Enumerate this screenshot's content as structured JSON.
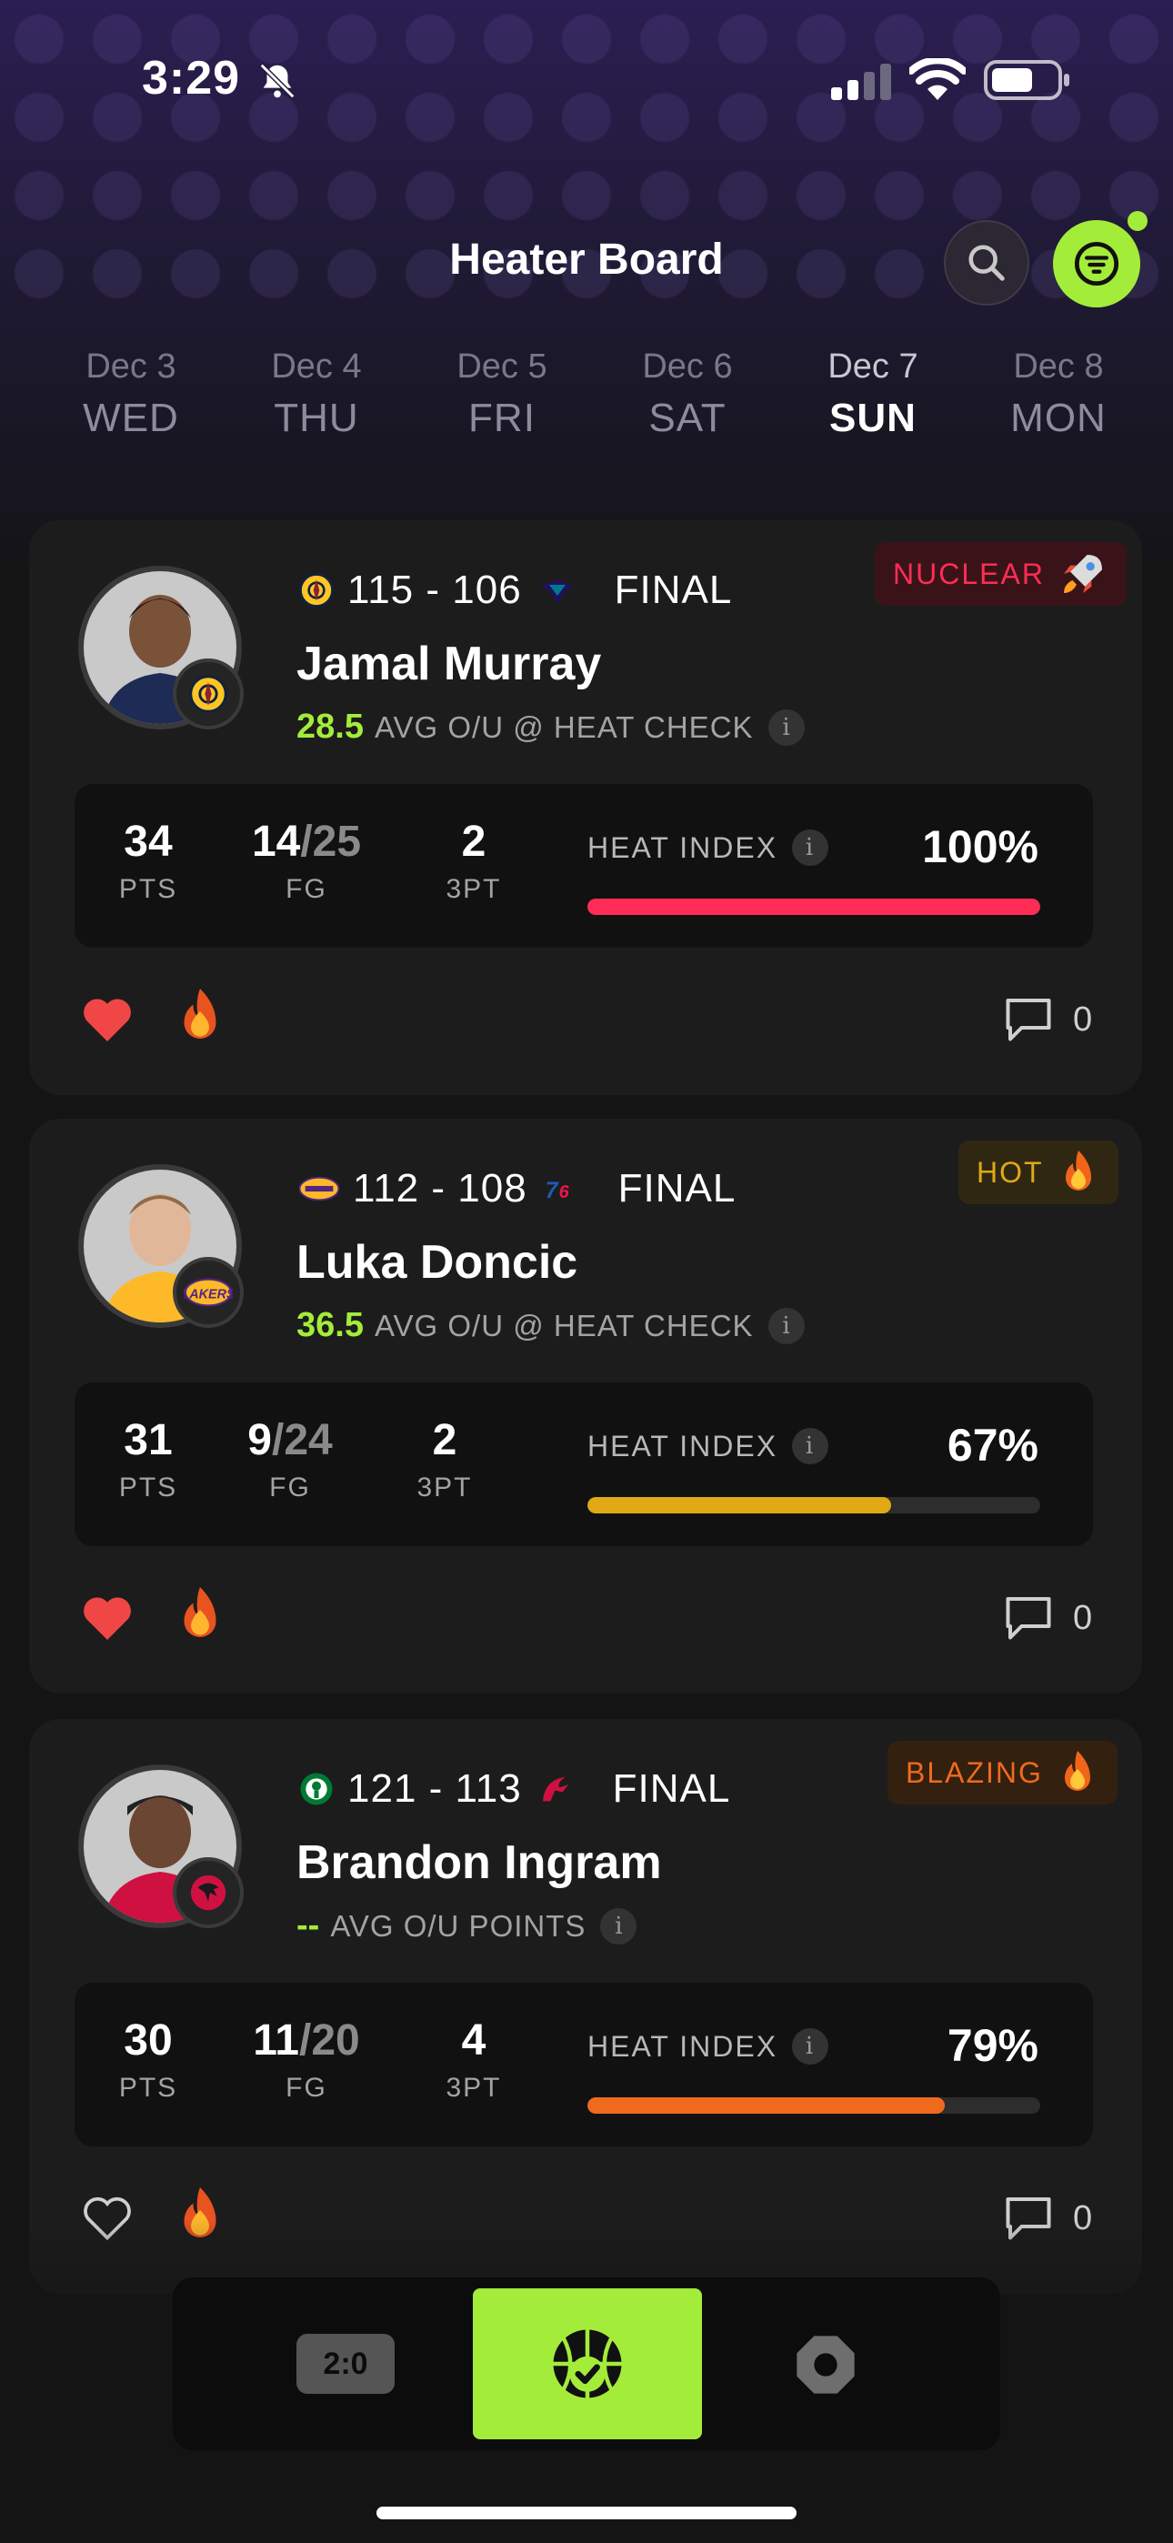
{
  "status_bar": {
    "time": "3:29"
  },
  "header": {
    "title": "Heater Board"
  },
  "dates": [
    {
      "date": "Dec 3",
      "weekday": "WED"
    },
    {
      "date": "Dec 4",
      "weekday": "THU"
    },
    {
      "date": "Dec 5",
      "weekday": "FRI"
    },
    {
      "date": "Dec 6",
      "weekday": "SAT"
    },
    {
      "date": "Dec 7",
      "weekday": "SUN",
      "active": true
    },
    {
      "date": "Dec 8",
      "weekday": "MON"
    }
  ],
  "cards": [
    {
      "score": "115 - 106",
      "status": "FINAL",
      "home_team_icon": "nuggets-logo-icon",
      "away_team_icon": "hornets-logo-icon",
      "player_name": "Jamal Murray",
      "ou_value": "28.5",
      "ou_label": "AVG O/U @ HEAT CHECK",
      "tier": "NUCLEAR",
      "tier_icon": "rocket-icon",
      "tier_color": "#ff2d55",
      "pts": "34",
      "pts_label": "PTS",
      "fg_made": "14",
      "fg_sep": "/",
      "fg_att": "25",
      "fg_label": "FG",
      "threes": "2",
      "threes_label": "3PT",
      "heat_label": "HEAT INDEX",
      "heat_pct": "100%",
      "heat_value": 1.0,
      "heat_color": "#ff2d55",
      "liked": true,
      "comments": "0"
    },
    {
      "score": "112 - 108",
      "status": "FINAL",
      "home_team_icon": "lakers-logo-icon",
      "away_team_icon": "76ers-logo-icon",
      "player_name": "Luka Doncic",
      "ou_value": "36.5",
      "ou_label": "AVG O/U @ HEAT CHECK",
      "tier": "HOT",
      "tier_icon": "fire-icon",
      "tier_color": "#e0a915",
      "pts": "31",
      "pts_label": "PTS",
      "fg_made": "9",
      "fg_sep": "/",
      "fg_att": "24",
      "fg_label": "FG",
      "threes": "2",
      "threes_label": "3PT",
      "heat_label": "HEAT INDEX",
      "heat_pct": "67%",
      "heat_value": 0.67,
      "heat_color": "#e0a915",
      "liked": true,
      "comments": "0"
    },
    {
      "score": "121 - 113",
      "status": "FINAL",
      "home_team_icon": "celtics-logo-icon",
      "away_team_icon": "raptors-logo-icon",
      "player_name": "Brandon Ingram",
      "ou_value": "--",
      "ou_label": "AVG O/U POINTS",
      "tier": "BLAZING",
      "tier_icon": "fire-icon",
      "tier_color": "#f06a1d",
      "pts": "30",
      "pts_label": "PTS",
      "fg_made": "11",
      "fg_sep": "/",
      "fg_att": "20",
      "fg_label": "FG",
      "threes": "4",
      "threes_label": "3PT",
      "heat_label": "HEAT INDEX",
      "heat_pct": "79%",
      "heat_value": 0.79,
      "heat_color": "#f06a1d",
      "liked": false,
      "comments": "0"
    }
  ],
  "bottom_nav": {
    "score_label": "2:0"
  },
  "colors": {
    "accent": "#a4ec3a",
    "background": "#141414",
    "card": "#1c1c1c"
  }
}
